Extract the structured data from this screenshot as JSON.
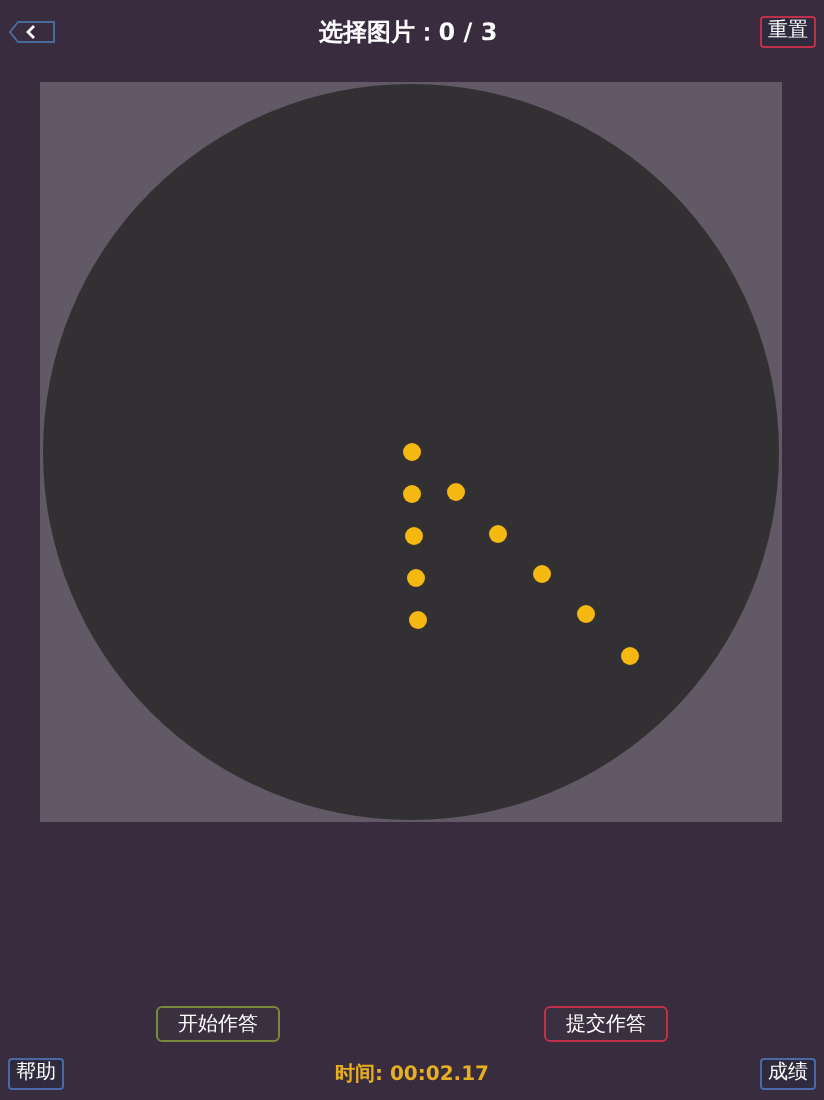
{
  "header": {
    "title": "选择图片：0 / 3",
    "reset_button": "重置"
  },
  "actions": {
    "start_button": "开始作答",
    "submit_button": "提交作答"
  },
  "footer": {
    "help_button": "帮助",
    "timer": "时间: 00:02.17",
    "score_button": "成绩"
  }
}
